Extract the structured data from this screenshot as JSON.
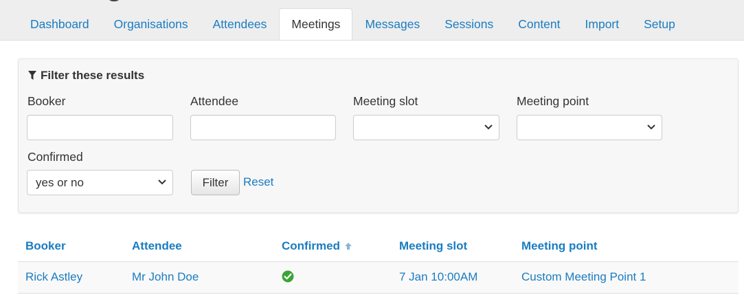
{
  "tabs": [
    {
      "label": "Dashboard",
      "active": false
    },
    {
      "label": "Organisations",
      "active": false
    },
    {
      "label": "Attendees",
      "active": false
    },
    {
      "label": "Meetings",
      "active": true
    },
    {
      "label": "Messages",
      "active": false
    },
    {
      "label": "Sessions",
      "active": false
    },
    {
      "label": "Content",
      "active": false
    },
    {
      "label": "Import",
      "active": false
    },
    {
      "label": "Setup",
      "active": false
    }
  ],
  "filter": {
    "title": "Filter these results",
    "title_icon": "funnel-icon",
    "fields": {
      "booker": {
        "label": "Booker",
        "value": ""
      },
      "attendee": {
        "label": "Attendee",
        "value": ""
      },
      "meeting_slot": {
        "label": "Meeting slot",
        "selected": ""
      },
      "meeting_point": {
        "label": "Meeting point",
        "selected": ""
      },
      "confirmed": {
        "label": "Confirmed",
        "selected": "yes or no"
      }
    },
    "filter_button": "Filter",
    "reset_link": "Reset"
  },
  "table": {
    "columns": [
      "Booker",
      "Attendee",
      "Confirmed",
      "Meeting slot",
      "Meeting point"
    ],
    "sorted_column": "Confirmed",
    "sort_direction": "ascending",
    "rows": [
      {
        "booker": "Rick Astley",
        "attendee": "Mr John Doe",
        "confirmed": true,
        "meeting_slot": "7 Jan 10:00AM",
        "meeting_point": "Custom Meeting Point 1"
      }
    ]
  },
  "colors": {
    "link": "#1a7cc1",
    "confirmed_green": "#3aa535"
  }
}
